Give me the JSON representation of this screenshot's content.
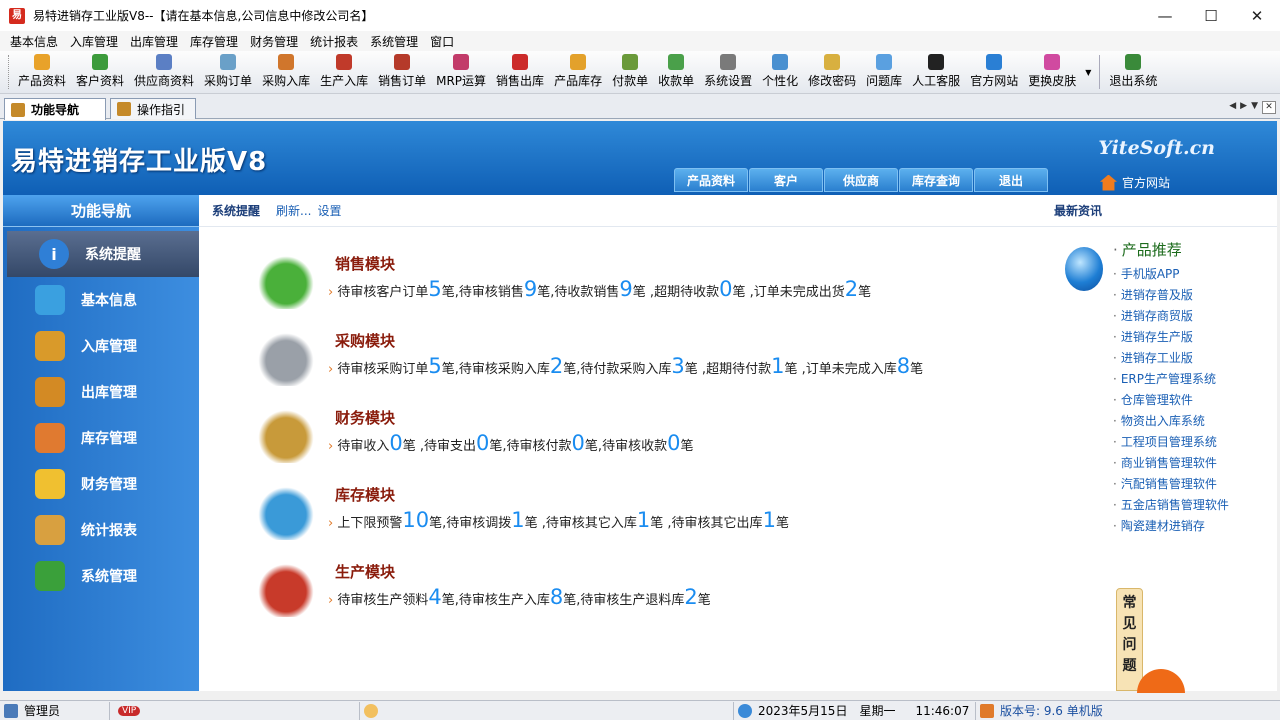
{
  "window": {
    "title": "易特进销存工业版V8--【请在基本信息,公司信息中修改公司名】",
    "app_icon_text": "易"
  },
  "menu": [
    "基本信息",
    "入库管理",
    "出库管理",
    "库存管理",
    "财务管理",
    "统计报表",
    "系统管理",
    "窗口"
  ],
  "toolbar": [
    {
      "label": "产品资料",
      "color": "#e8a22a"
    },
    {
      "label": "客户资料",
      "color": "#3c9b3c"
    },
    {
      "label": "供应商资料",
      "color": "#5b7fc4"
    },
    {
      "label": "采购订单",
      "color": "#6aa0c8"
    },
    {
      "label": "采购入库",
      "color": "#d0762c"
    },
    {
      "label": "生产入库",
      "color": "#c03a2a"
    },
    {
      "label": "销售订单",
      "color": "#b53a2a"
    },
    {
      "label": "MRP运算",
      "color": "#c23b6a"
    },
    {
      "label": "销售出库",
      "color": "#cc2b2b"
    },
    {
      "label": "产品库存",
      "color": "#e3a12b"
    },
    {
      "label": "付款单",
      "color": "#6a9a3a"
    },
    {
      "label": "收款单",
      "color": "#4aa04a"
    },
    {
      "label": "系统设置",
      "color": "#7a7a7a"
    },
    {
      "label": "个性化",
      "color": "#4a90d0"
    },
    {
      "label": "修改密码",
      "color": "#d8b040"
    },
    {
      "label": "问题库",
      "color": "#5aa0e0"
    },
    {
      "label": "人工客服",
      "color": "#222222"
    },
    {
      "label": "官方网站",
      "color": "#2a7fd4"
    },
    {
      "label": "更换皮肤",
      "color": "#d04aa0"
    },
    {
      "label": "退出系统",
      "color": "#3a8a3a"
    }
  ],
  "tabs": [
    {
      "label": "功能导航",
      "active": true
    },
    {
      "label": "操作指引",
      "active": false
    }
  ],
  "banner": {
    "title": "易特进销存工业版V8",
    "brand": "YiteSoft.cn",
    "tabs": [
      "产品资料",
      "客户",
      "供应商",
      "库存查询",
      "退出"
    ],
    "official_site": "官方网站"
  },
  "sidebar": {
    "header": "功能导航",
    "items": [
      {
        "label": "系统提醒",
        "color": "#2f7fd6",
        "glyph": "i"
      },
      {
        "label": "基本信息",
        "color": "#3aa0e0",
        "glyph": ""
      },
      {
        "label": "入库管理",
        "color": "#d99a2a",
        "glyph": ""
      },
      {
        "label": "出库管理",
        "color": "#d38a24",
        "glyph": ""
      },
      {
        "label": "库存管理",
        "color": "#e07a30",
        "glyph": ""
      },
      {
        "label": "财务管理",
        "color": "#f0c030",
        "glyph": ""
      },
      {
        "label": "统计报表",
        "color": "#d8a040",
        "glyph": ""
      },
      {
        "label": "系统管理",
        "color": "#3aa03a",
        "glyph": ""
      }
    ]
  },
  "content_header": {
    "title": "系统提醒",
    "refresh": "刷新...",
    "settings": "设置",
    "news": "最新资讯"
  },
  "modules": [
    {
      "title": "销售模块",
      "color": "#4ab03a",
      "parts": [
        [
          "待审核客户订单",
          "5",
          "笔,"
        ],
        [
          "待审核销售",
          "9",
          "笔,"
        ],
        [
          "待收款销售",
          "9",
          "笔 ,"
        ],
        [
          "超期待收款",
          "0",
          "笔 ,"
        ],
        [
          "订单未完成出货",
          "2",
          "笔"
        ]
      ]
    },
    {
      "title": "采购模块",
      "color": "#9aa0a8",
      "parts": [
        [
          "待审核采购订单",
          "5",
          "笔,"
        ],
        [
          "待审核采购入库",
          "2",
          "笔,"
        ],
        [
          "待付款采购入库",
          "3",
          "笔 ,"
        ],
        [
          "超期待付款",
          "1",
          "笔 ,"
        ],
        [
          "订单未完成入库",
          "8",
          "笔"
        ]
      ]
    },
    {
      "title": "财务模块",
      "color": "#c89a3a",
      "parts": [
        [
          "待审收入",
          "0",
          "笔 ,"
        ],
        [
          "待审支出",
          "0",
          "笔,"
        ],
        [
          "待审核付款",
          "0",
          "笔,"
        ],
        [
          "待审核收款",
          "0",
          "笔"
        ]
      ]
    },
    {
      "title": "库存模块",
      "color": "#3a9ad8",
      "parts": [
        [
          "上下限预警",
          "10",
          "笔,"
        ],
        [
          "待审核调拨",
          "1",
          "笔 ,"
        ],
        [
          "待审核其它入库",
          "1",
          "笔 ,"
        ],
        [
          "待审核其它出库",
          "1",
          "笔"
        ]
      ]
    },
    {
      "title": "生产模块",
      "color": "#c83a2a",
      "parts": [
        [
          "待审核生产领料",
          "4",
          "笔,"
        ],
        [
          "待审核生产入库",
          "8",
          "笔,"
        ],
        [
          "待审核生产退料库",
          "2",
          "笔"
        ]
      ]
    }
  ],
  "news": {
    "heading": "产品推荐",
    "items": [
      "手机版APP",
      "进销存普及版",
      "进销存商贸版",
      "进销存生产版",
      "进销存工业版",
      "ERP生产管理系统",
      "仓库管理软件",
      "物资出入库系统",
      "工程项目管理系统",
      "商业销售管理软件",
      "汽配销售管理软件",
      "五金店销售管理软件",
      "陶瓷建材进销存"
    ]
  },
  "faq": [
    "常",
    "见",
    "问",
    "题"
  ],
  "status": {
    "user": "管理员",
    "vip": "VIP",
    "date": "2023年5月15日",
    "weekday": "星期一",
    "time": "11:46:07",
    "version": "版本号: 9.6 单机版"
  }
}
